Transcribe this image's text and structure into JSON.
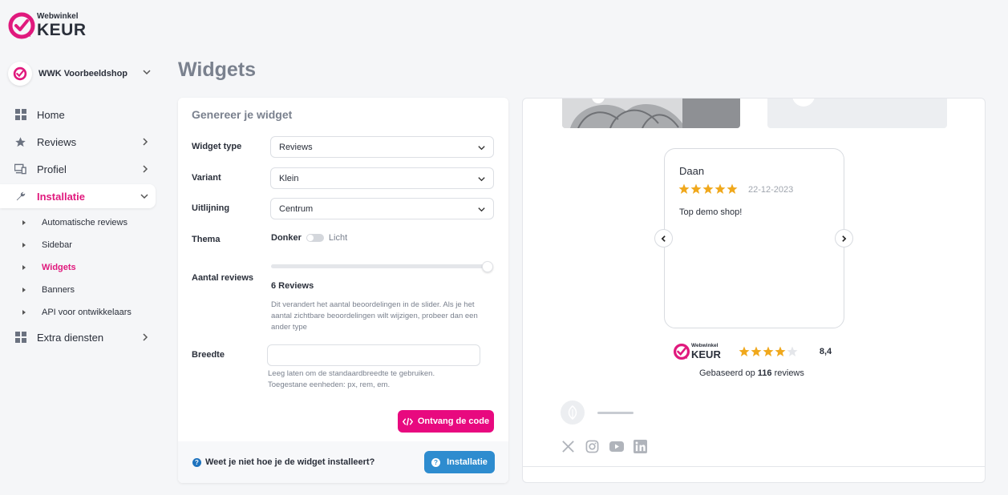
{
  "brand": {
    "logo_small": "Webwinkel",
    "logo_big": "KEUR",
    "accent": "#e0197d"
  },
  "shop": {
    "name": "WWK Voorbeeldshop"
  },
  "nav": {
    "home": "Home",
    "reviews": "Reviews",
    "profiel": "Profiel",
    "installatie": "Installatie",
    "sub": [
      "Automatische reviews",
      "Sidebar",
      "Widgets",
      "Banners",
      "API voor ontwikkelaars"
    ],
    "extra": "Extra diensten"
  },
  "page": {
    "title": "Widgets"
  },
  "form": {
    "title": "Genereer je widget",
    "widget_type_label": "Widget type",
    "widget_type_value": "Reviews",
    "variant_label": "Variant",
    "variant_value": "Klein",
    "alignment_label": "Uitlijning",
    "alignment_value": "Centrum",
    "theme_label": "Thema",
    "theme_dark": "Donker",
    "theme_light": "Licht",
    "count_label": "Aantal reviews",
    "count_value": "6 Reviews",
    "count_fraction": 1.0,
    "count_help": "Dit verandert het aantal beoordelingen in de slider. Als je het aantal zichtbare beoordelingen wilt wijzigen, probeer dan een ander type",
    "width_label": "Breedte",
    "width_value": "",
    "width_help_1": "Leeg laten om de standaardbreedte te gebruiken.",
    "width_help_2": "Toegestane eenheden: px, rem, em.",
    "code_button": "Ontvang de code",
    "footer_question": "Weet je niet hoe je de widget installeert?",
    "install_button": "Installatie"
  },
  "preview": {
    "review": {
      "name": "Daan",
      "date": "22-12-2023",
      "text": "Top demo shop!",
      "stars": 5
    },
    "rating": {
      "stars": 4,
      "score": "8,4",
      "based_prefix": "Gebaseerd op",
      "based_count": "116",
      "based_suffix": "reviews"
    },
    "socials": [
      "x-icon",
      "instagram-icon",
      "youtube-icon",
      "linkedin-icon"
    ]
  }
}
